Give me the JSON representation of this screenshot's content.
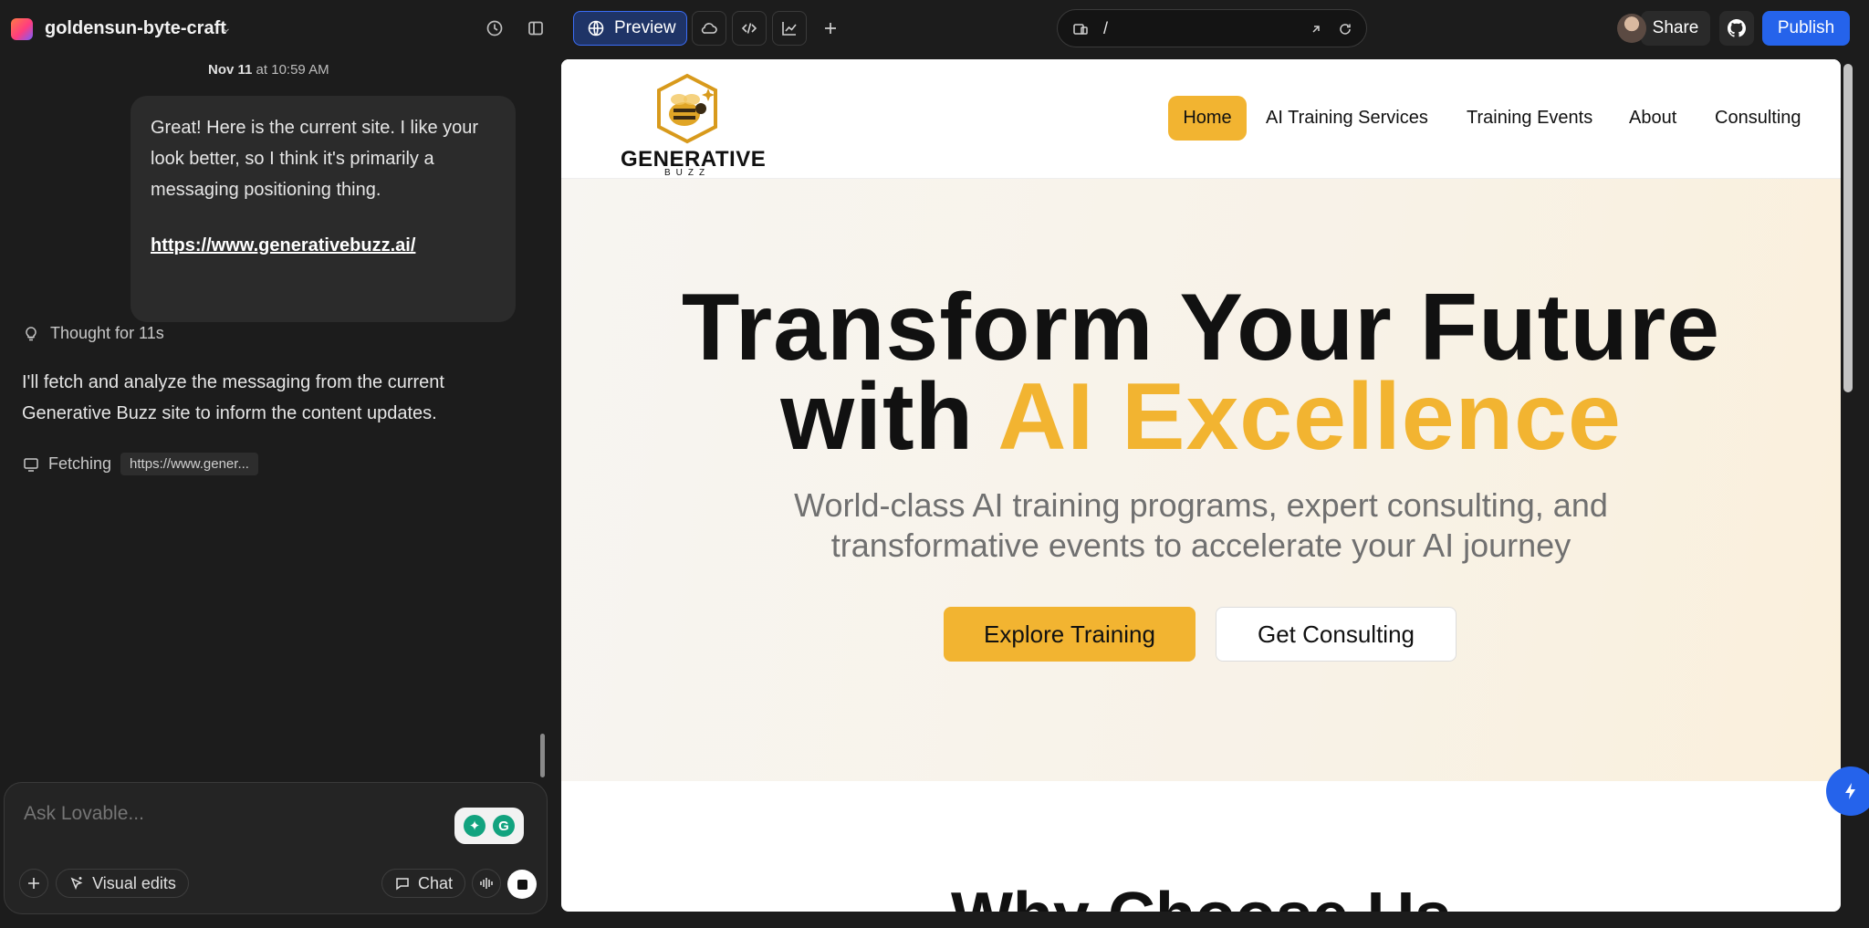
{
  "topbar": {
    "project_name": "goldensun-byte-craft",
    "preview_label": "Preview",
    "url_path": "/",
    "share_label": "Share",
    "publish_label": "Publish"
  },
  "chat": {
    "date_day": "Nov 11",
    "date_time": "at 10:59 AM",
    "user_message": "Great! Here is the current site. I like your look better, so I think it's primarily a messaging positioning thing.",
    "user_link": "https://www.generativebuzz.ai/",
    "thought_label": "Thought for 11s",
    "assistant_reply": "I'll fetch and analyze the messaging from the current Generative Buzz site to inform the content updates.",
    "fetching_label": "Fetching",
    "fetching_chip": "https://www.gener..."
  },
  "composer": {
    "placeholder": "Ask Lovable...",
    "visual_edits_label": "Visual edits",
    "chat_label": "Chat"
  },
  "site": {
    "brand_word": "GENERATIVE",
    "brand_sub": "BUZZ",
    "nav": {
      "home": "Home",
      "ai_training": "AI Training Services",
      "events": "Training Events",
      "about": "About",
      "consulting": "Consulting"
    },
    "hero": {
      "line1": "Transform Your Future",
      "line2_dark": "with",
      "line2_gold": "AI Excellence",
      "subtitle": "World-class AI training programs, expert consulting, and transformative events to accelerate your AI journey",
      "cta_primary": "Explore Training",
      "cta_secondary": "Get Consulting"
    },
    "next_heading": "Why Choose Us"
  },
  "colors": {
    "accent_gold": "#f2b431",
    "publish_blue": "#2563eb"
  }
}
